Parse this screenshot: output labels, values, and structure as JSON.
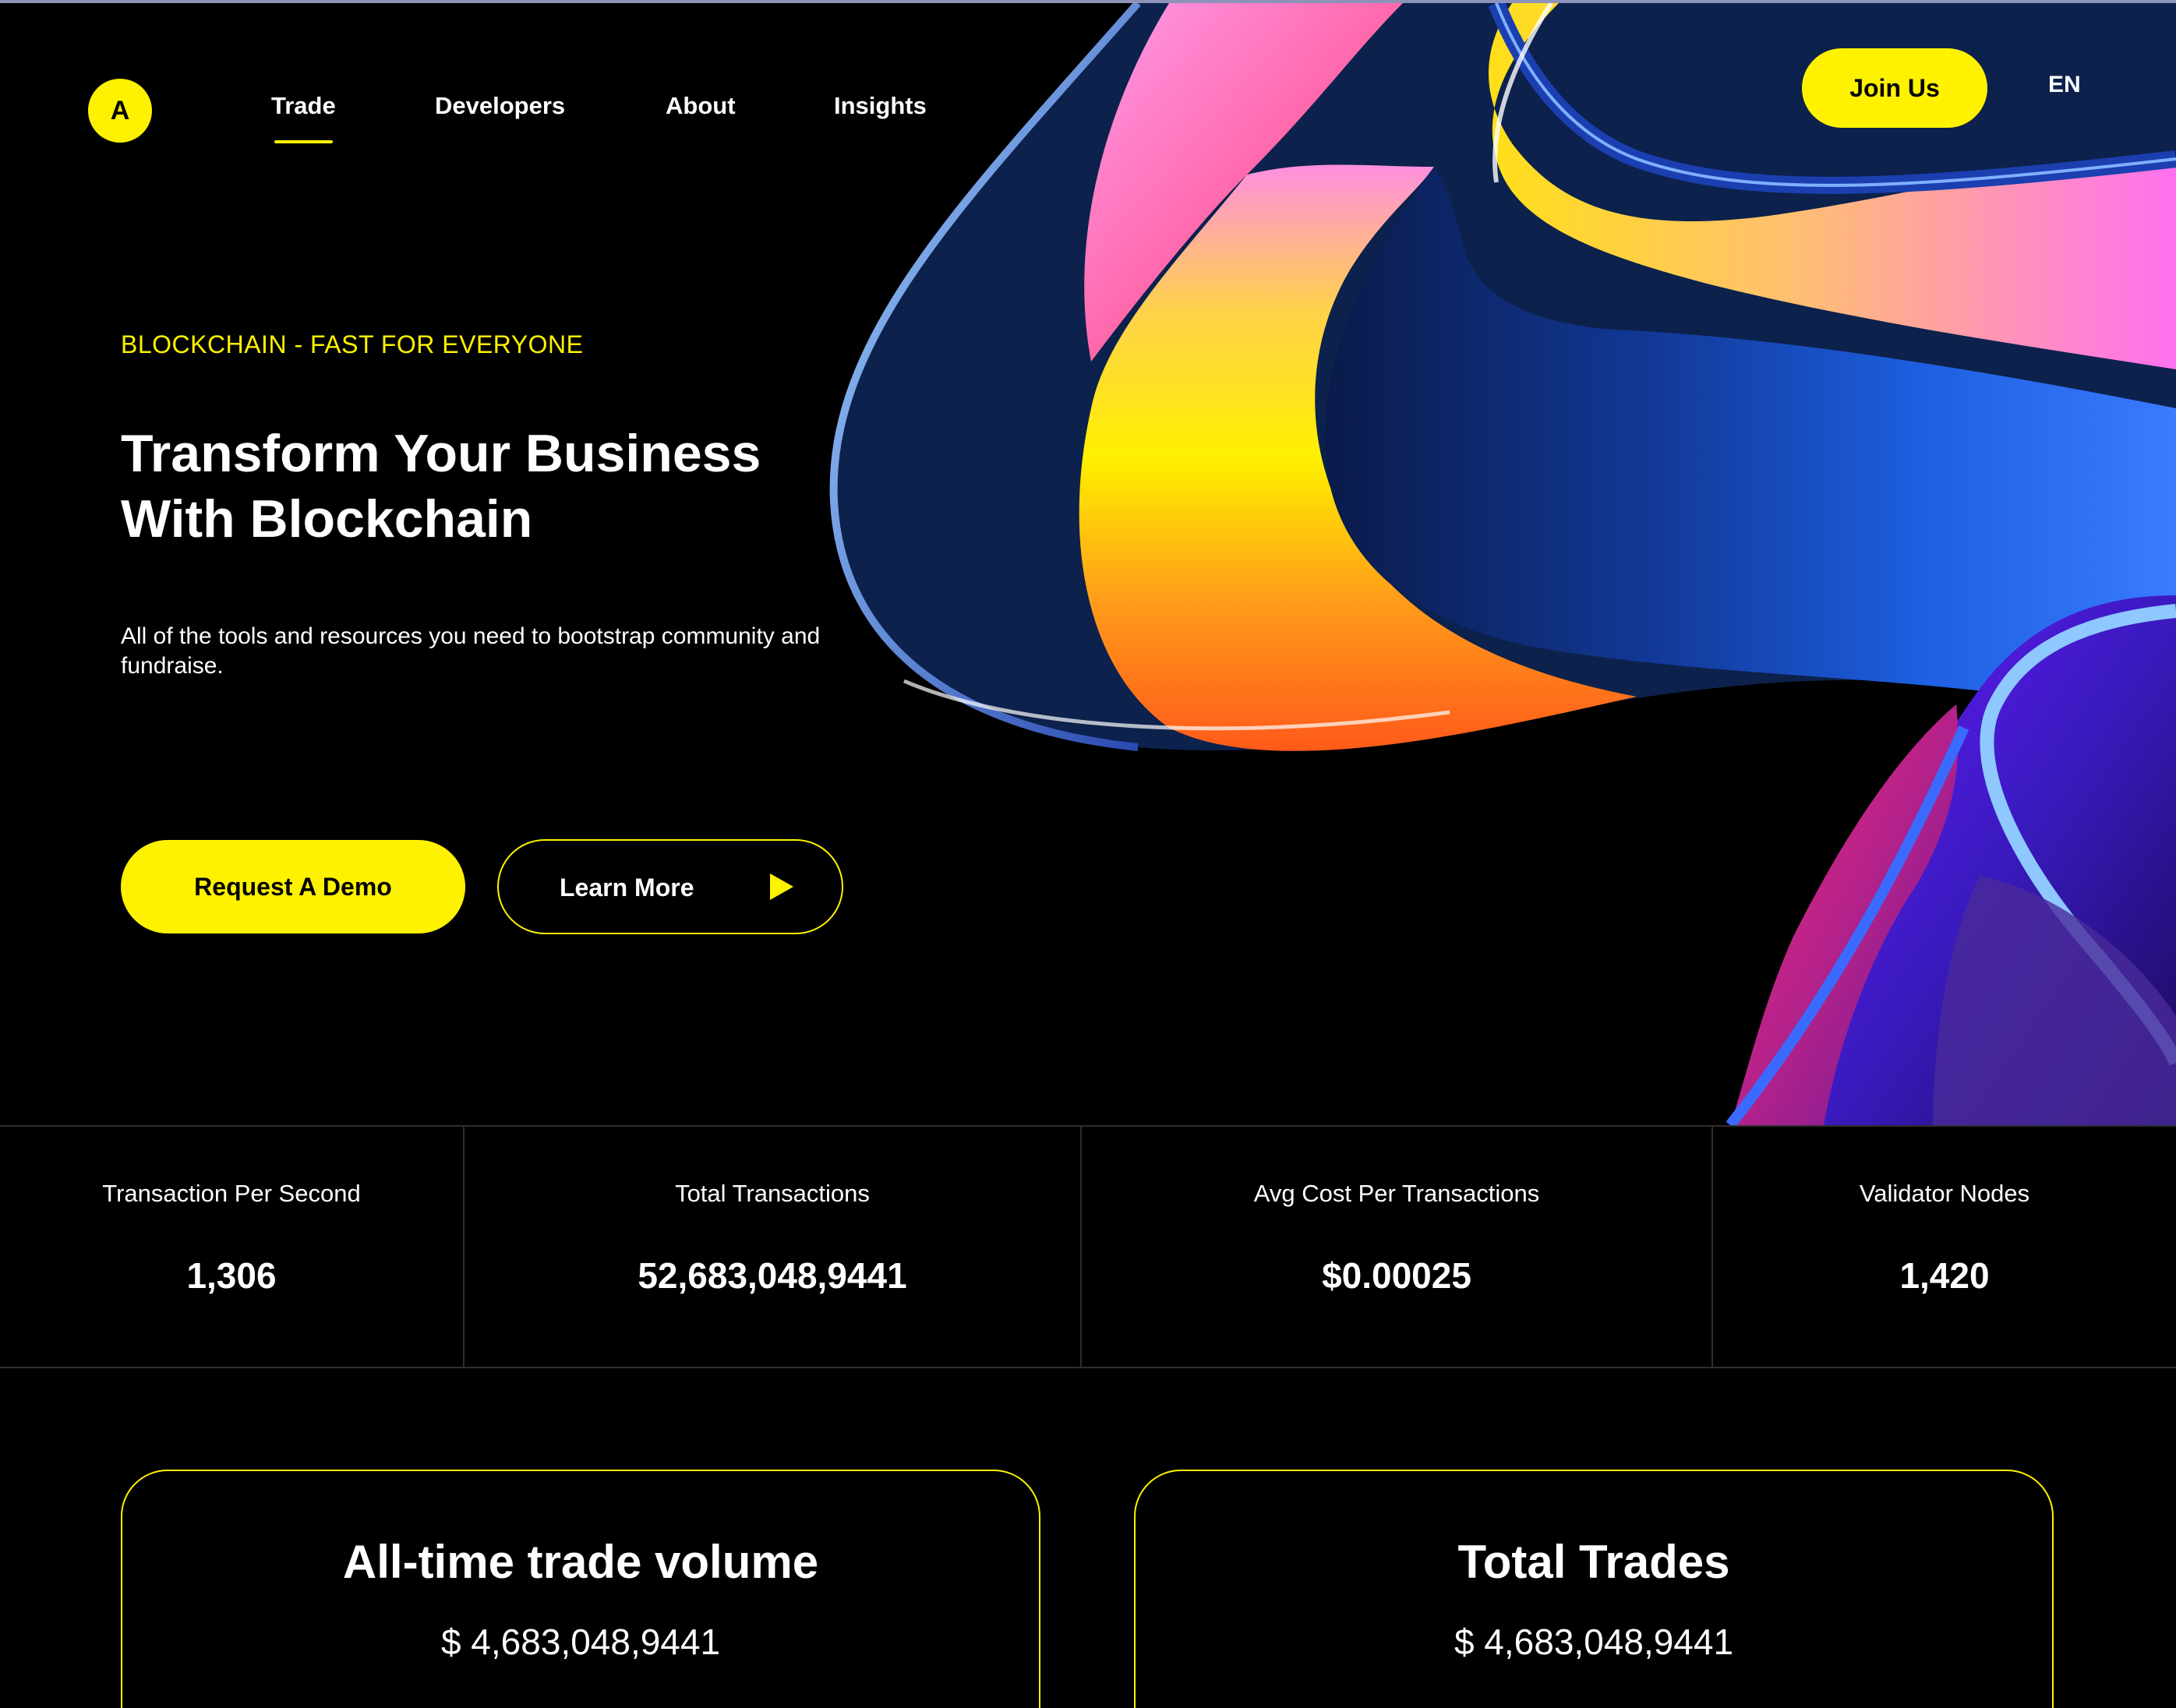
{
  "nav": {
    "logo_letter": "A",
    "items": [
      {
        "label": "Trade",
        "active": true
      },
      {
        "label": "Developers",
        "active": false
      },
      {
        "label": "About",
        "active": false
      },
      {
        "label": "Insights",
        "active": false
      }
    ],
    "join_label": "Join Us",
    "language": "EN"
  },
  "hero": {
    "eyebrow": "BLOCKCHAIN - FAST FOR EVERYONE",
    "title_line1": "Transform Your Business",
    "title_line2": "With Blockchain",
    "subtitle": "All of the tools and resources you need to bootstrap community and fundraise.",
    "primary_cta": "Request A Demo",
    "secondary_cta": "Learn More"
  },
  "stats": [
    {
      "label": "Transaction Per Second",
      "value": "1,306"
    },
    {
      "label": "Total Transactions",
      "value": "52,683,048,9441"
    },
    {
      "label": "Avg Cost Per Transactions",
      "value": "$0.00025"
    },
    {
      "label": "Validator Nodes",
      "value": "1,420"
    }
  ],
  "cards": [
    {
      "title": "All-time trade volume",
      "value": "$ 4,683,048,9441"
    },
    {
      "title": "Total Trades",
      "value": "$ 4,683,048,9441"
    }
  ],
  "colors": {
    "accent": "#fff200",
    "background": "#000000",
    "divider": "#2e2e2e"
  }
}
